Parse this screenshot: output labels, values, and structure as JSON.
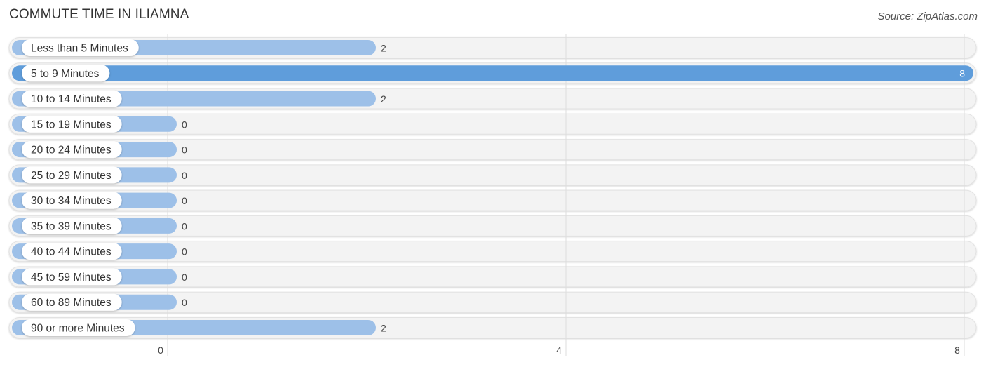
{
  "header": {
    "title": "COMMUTE TIME IN ILIAMNA",
    "source": "Source: ZipAtlas.com"
  },
  "colors": {
    "bar_normal": "#9dc0e8",
    "bar_highlight": "#5f9ddb",
    "track": "#f3f3f3",
    "grid": "#dddddd"
  },
  "chart_data": {
    "type": "bar",
    "orientation": "horizontal",
    "title": "COMMUTE TIME IN ILIAMNA",
    "xlabel": "",
    "ylabel": "",
    "categories": [
      "Less than 5 Minutes",
      "5 to 9 Minutes",
      "10 to 14 Minutes",
      "15 to 19 Minutes",
      "20 to 24 Minutes",
      "25 to 29 Minutes",
      "30 to 34 Minutes",
      "35 to 39 Minutes",
      "40 to 44 Minutes",
      "45 to 59 Minutes",
      "60 to 89 Minutes",
      "90 or more Minutes"
    ],
    "values": [
      2,
      8,
      2,
      0,
      0,
      0,
      0,
      0,
      0,
      0,
      0,
      2
    ],
    "highlight_index": 1,
    "xlim": [
      0,
      8
    ],
    "xticks": [
      0,
      4,
      8
    ],
    "grid": true,
    "legend": "none"
  }
}
